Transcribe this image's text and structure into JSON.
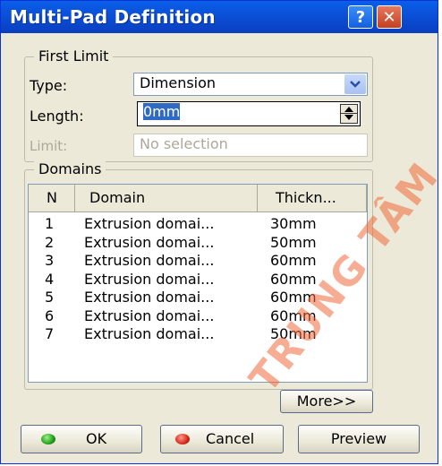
{
  "window": {
    "title": "Multi-Pad Definition",
    "help_glyph": "?",
    "close_glyph": "✕"
  },
  "first_limit": {
    "legend": "First Limit",
    "type_label": "Type:",
    "type_value": "Dimension",
    "length_label": "Length:",
    "length_value": "0mm",
    "limit_label": "Limit:",
    "limit_value": "No selection"
  },
  "domains": {
    "legend": "Domains",
    "columns": [
      "N",
      "Domain",
      "Thickn..."
    ],
    "rows": [
      [
        "1",
        "Extrusion domai...",
        "30mm"
      ],
      [
        "2",
        "Extrusion domai...",
        "50mm"
      ],
      [
        "3",
        "Extrusion domai...",
        "60mm"
      ],
      [
        "4",
        "Extrusion domai...",
        "60mm"
      ],
      [
        "5",
        "Extrusion domai...",
        "60mm"
      ],
      [
        "6",
        "Extrusion domai...",
        "60mm"
      ],
      [
        "7",
        "Extrusion domai...",
        "50mm"
      ]
    ]
  },
  "buttons": {
    "more": "More>>",
    "ok": "OK",
    "cancel": "Cancel",
    "preview": "Preview"
  },
  "watermark_text": "TRUNG TÂM",
  "colors": {
    "title_bar": "#0a5fe8",
    "dialog_bg": "#ece9d8",
    "selection": "#316ac5",
    "watermark": "#f06a3a"
  },
  "icons": [
    "help-icon",
    "close-icon",
    "dropdown-arrow-icon",
    "spin-icon",
    "ok-status-icon",
    "cancel-status-icon"
  ]
}
